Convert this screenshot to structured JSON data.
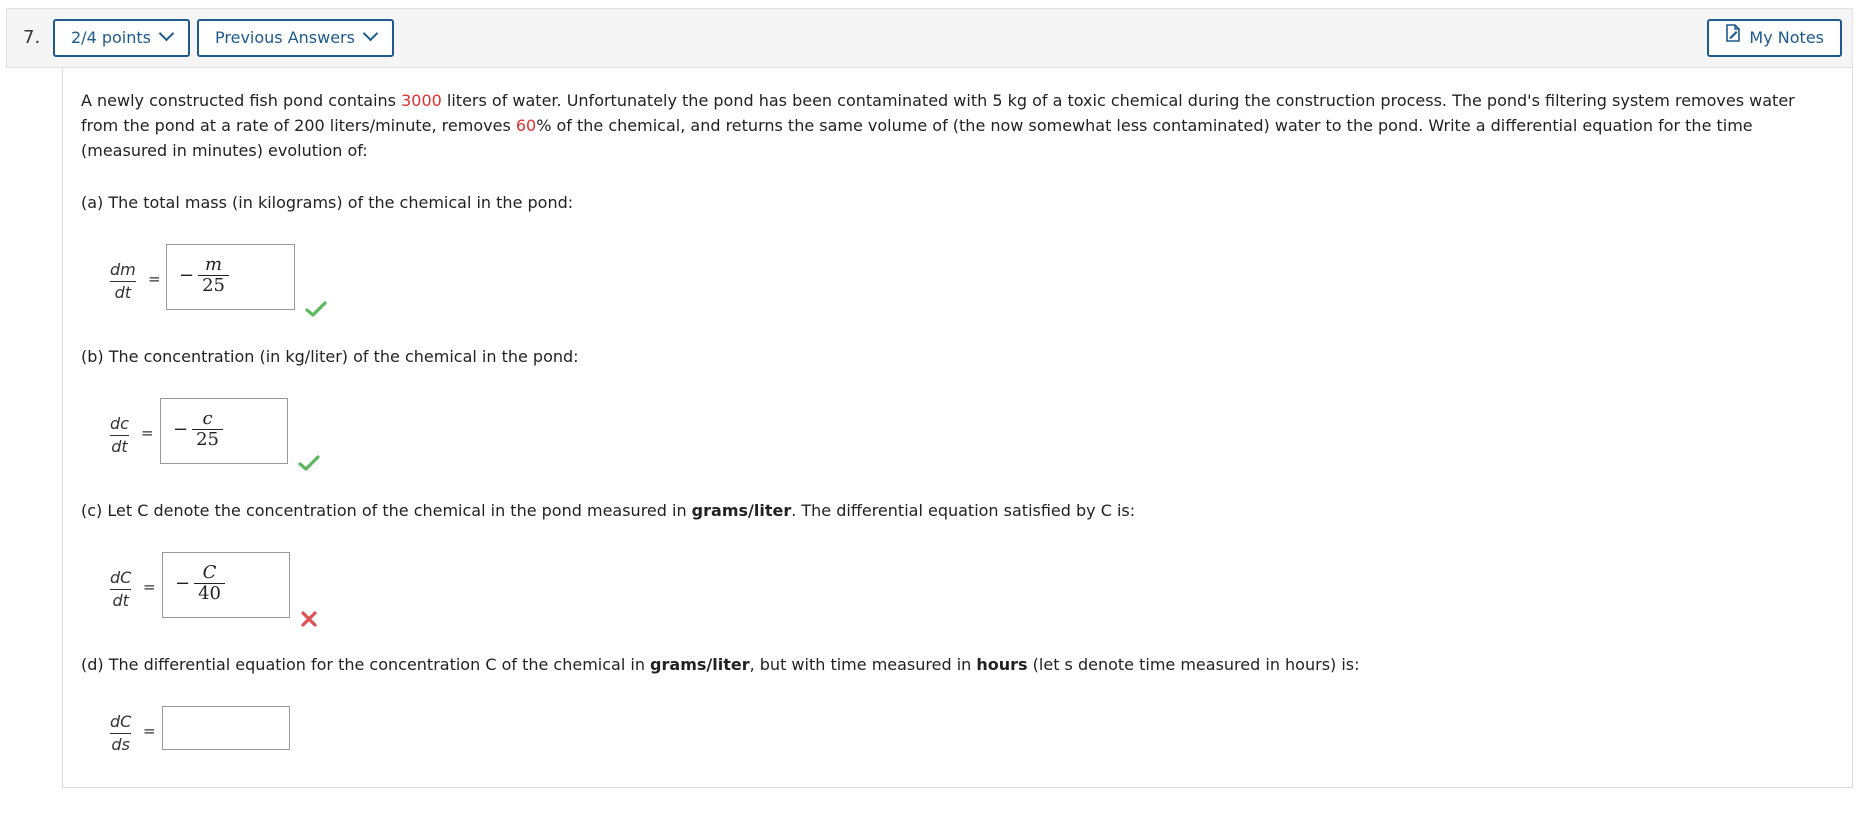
{
  "question": {
    "number": "7.",
    "points_label": "2/4 points",
    "previous_answers_label": "Previous Answers",
    "my_notes_label": "My Notes"
  },
  "prompt": {
    "part1": "A newly constructed fish pond contains ",
    "volume": "3000",
    "part2": " liters of water. Unfortunately the pond has been contaminated with 5 kg of a toxic chemical during the construction process. The pond's filtering system removes water from the pond at a rate of 200 liters/minute, removes ",
    "percent": "60",
    "part3": "% of the chemical, and returns the same volume of (the now somewhat less contaminated) water to the pond. Write a differential equation for the time (measured in minutes) evolution of:"
  },
  "parts": [
    {
      "text": "(a) The total mass (in kilograms) of the chemical in the pond:",
      "lhs_num": "dm",
      "lhs_den": "dt",
      "eq": "=",
      "ans_sign": "−",
      "ans_num": "m",
      "ans_den": "25",
      "status": "correct"
    },
    {
      "text": "(b) The concentration (in kg/liter) of the chemical in the pond:",
      "lhs_num": "dc",
      "lhs_den": "dt",
      "eq": "=",
      "ans_sign": "−",
      "ans_num": "c",
      "ans_den": "25",
      "status": "correct"
    },
    {
      "text_pre": "(c) Let C denote the concentration of the chemical in the pond measured in ",
      "text_bold": "grams/liter",
      "text_post": ". The differential equation satisfied by C is:",
      "lhs_num": "dC",
      "lhs_den": "dt",
      "eq": "=",
      "ans_sign": "−",
      "ans_num": "C",
      "ans_den": "40",
      "status": "incorrect"
    },
    {
      "text_pre": "(d) The differential equation for the concentration C of the chemical in ",
      "text_bold1": "grams/liter",
      "text_mid": ", but with time measured in ",
      "text_bold2": "hours",
      "text_post": " (let s denote time measured in hours) is:",
      "lhs_num": "dC",
      "lhs_den": "ds",
      "eq": "=",
      "answer": "",
      "status": "unanswered"
    }
  ],
  "colors": {
    "accent": "#1f5a8e",
    "highlight": "#e03030",
    "correct": "#5cb85c",
    "incorrect": "#e05050"
  },
  "icons": {
    "dropdown": "chevron-down-icon",
    "notes": "notes-icon",
    "correct": "checkmark-icon",
    "incorrect": "x-mark-icon"
  }
}
